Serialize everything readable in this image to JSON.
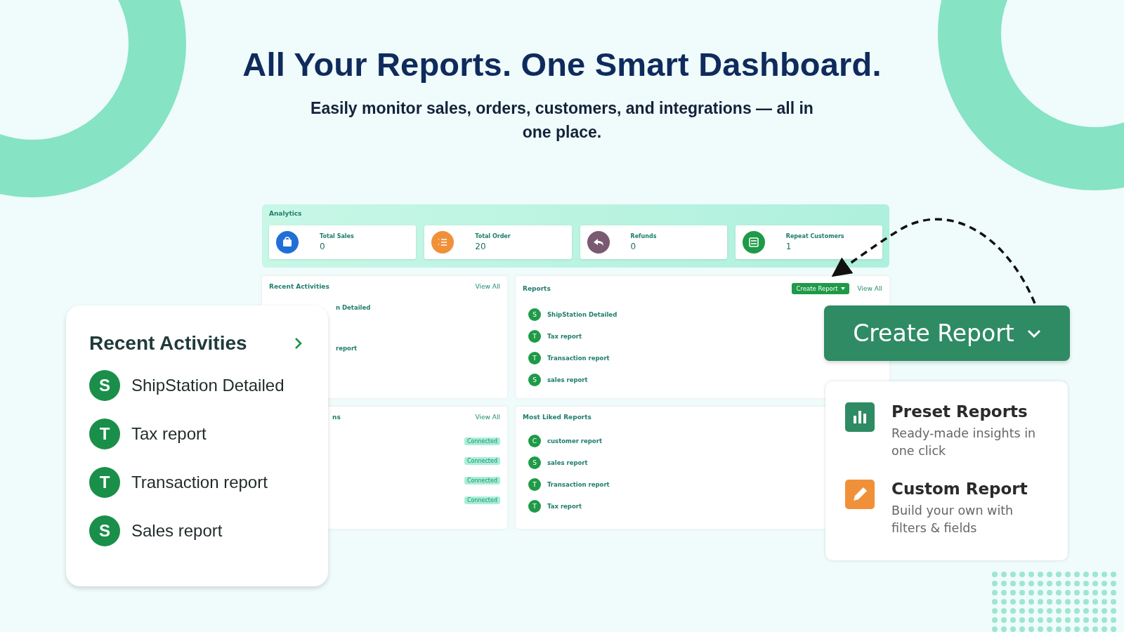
{
  "headline": "All Your Reports. One Smart Dashboard.",
  "subheadline": "Easily monitor sales, orders, customers, and integrations — all in one place.",
  "dashboard": {
    "analytics": {
      "title": "Analytics",
      "stats": [
        {
          "kind": "sales",
          "label": "Total Sales",
          "value": "0",
          "color": "#1f6fd6"
        },
        {
          "kind": "orders",
          "label": "Total Order",
          "value": "20",
          "color": "#f0913a"
        },
        {
          "kind": "refunds",
          "label": "Refunds",
          "value": "0",
          "color": "#7a5a70"
        },
        {
          "kind": "customers",
          "label": "Repeat Customers",
          "value": "1",
          "color": "#1f9a48"
        }
      ]
    },
    "recent_activities": {
      "title": "Recent Activities",
      "view_all": "View All",
      "items": [
        "n Detailed",
        "report"
      ]
    },
    "reports": {
      "title": "Reports",
      "create_button": "Create Report",
      "view_all": "View All",
      "items": [
        {
          "initial": "S",
          "name": "ShipStation Detailed"
        },
        {
          "initial": "T",
          "name": "Tax report"
        },
        {
          "initial": "T",
          "name": "Transaction report"
        },
        {
          "initial": "S",
          "name": "sales report"
        }
      ]
    },
    "integrations": {
      "title": "ns",
      "view_all": "View All",
      "items": [
        {
          "status": "Connected"
        },
        {
          "status": "Connected"
        },
        {
          "status": "Connected"
        },
        {
          "status": "Connected"
        }
      ]
    },
    "most_liked": {
      "title": "Most Liked Reports",
      "items": [
        {
          "initial": "C",
          "name": "customer report"
        },
        {
          "initial": "S",
          "name": "sales report"
        },
        {
          "initial": "T",
          "name": "Transaction report"
        },
        {
          "initial": "T",
          "name": "Tax report"
        }
      ]
    }
  },
  "recent_card": {
    "title": "Recent Activities",
    "items": [
      {
        "initial": "S",
        "name": "ShipStation Detailed"
      },
      {
        "initial": "T",
        "name": "Tax report"
      },
      {
        "initial": "T",
        "name": "Transaction report"
      },
      {
        "initial": "S",
        "name": "Sales report"
      }
    ]
  },
  "create_button": {
    "label": "Create Report"
  },
  "options": [
    {
      "kind": "preset",
      "title": "Preset Reports",
      "description": "Ready-made insights in one click"
    },
    {
      "kind": "custom",
      "title": "Custom Report",
      "description": "Build your own with filters & fields"
    }
  ]
}
